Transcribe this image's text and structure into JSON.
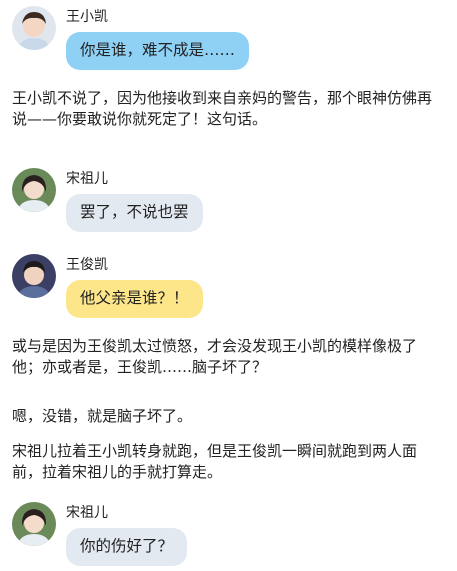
{
  "chat": {
    "msg1": {
      "name": "王小凯",
      "text": "你是谁，难不成是……",
      "avatar_icon": "boy-avatar-icon"
    },
    "narr1": "王小凯不说了，因为他接收到来自亲妈的警告，那个眼神仿佛再说——你要敢说你就死定了！这句话。",
    "msg2": {
      "name": "宋祖儿",
      "text": "罢了，不说也罢",
      "avatar_icon": "girl-avatar-icon"
    },
    "msg3": {
      "name": "王俊凯",
      "text": "他父亲是谁？！",
      "avatar_icon": "man-avatar-icon"
    },
    "narr2": "或与是因为王俊凯太过愤怒，才会没发现王小凯的模样像极了他；亦或者是，王俊凯……脑子坏了？",
    "narr3": "嗯，没错，就是脑子坏了。",
    "narr4": "宋祖儿拉着王小凯转身就跑，但是王俊凯一瞬间就跑到两人面前，拉着宋祖儿的手就打算走。",
    "msg4": {
      "name": "宋祖儿",
      "text": "你的伤好了？",
      "avatar_icon": "girl-avatar-icon"
    }
  },
  "colors": {
    "blue_bubble": "#8fd0f5",
    "gray_bubble": "#e3e9f1",
    "yellow_bubble": "#fde68a"
  }
}
